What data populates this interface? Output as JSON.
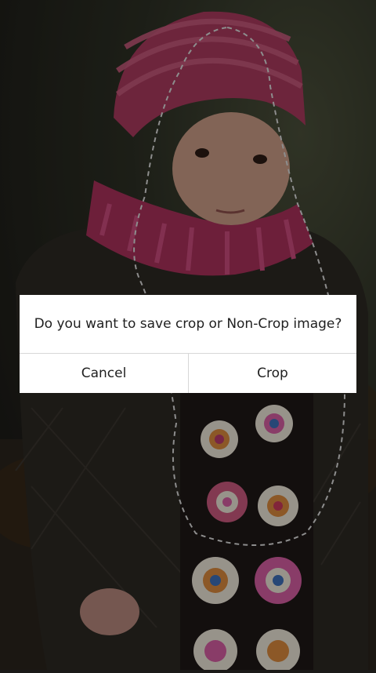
{
  "dialog": {
    "message": "Do you want to save crop or Non-Crop image?",
    "cancel_label": "Cancel",
    "crop_label": "Crop"
  }
}
